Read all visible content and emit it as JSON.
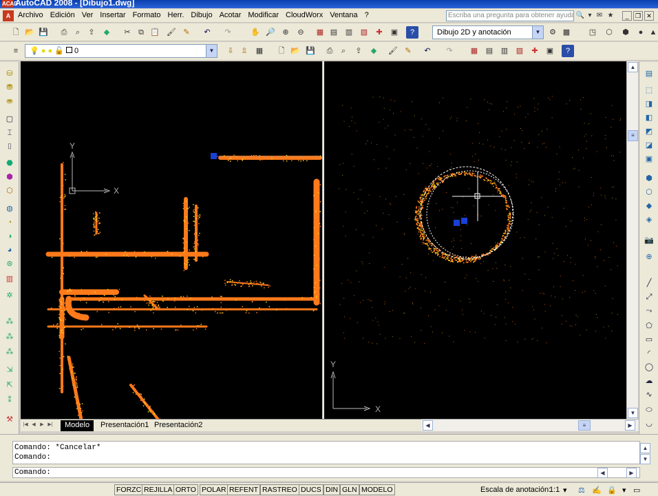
{
  "window": {
    "title": "AutoCAD 2008 - [Dibujo1.dwg]",
    "app_icon": "ACAD"
  },
  "menu": {
    "items": [
      "Archivo",
      "Edición",
      "Ver",
      "Insertar",
      "Formato",
      "Herr.",
      "Dibujo",
      "Acotar",
      "Modificar",
      "CloudWorx",
      "Ventana",
      "?"
    ],
    "help_placeholder": "Escriba una pregunta para obtener ayuda"
  },
  "toolbar": {
    "workspace": "Dibujo 2D y anotación",
    "layer": "0"
  },
  "viewports": {
    "left": {
      "ucs_x": "X",
      "ucs_y": "Y"
    },
    "right": {
      "ucs_x": "X",
      "ucs_y": "Y"
    }
  },
  "tabs": [
    "Modelo",
    "Presentación1",
    "Presentación2"
  ],
  "active_tab": "Modelo",
  "command": {
    "history": [
      "Comando: *Cancelar*",
      "Comando:"
    ],
    "prompt": "Comando:"
  },
  "status": {
    "toggles": [
      "FORZC",
      "REJILLA",
      "ORTO",
      "POLAR",
      "REFENT",
      "RASTREO",
      "DUCS",
      "DIN",
      "GLN",
      "MODELO"
    ],
    "annotation_scale_label": "Escala de anotación:",
    "annotation_scale_value": "1:1"
  },
  "colors": {
    "titlebar": "#0a3fae",
    "pointcloud_primary": "#ff7a1a",
    "pointcloud_highlight": "#ffd21a",
    "grip": "#1a3fd6",
    "canvas": "#000000"
  }
}
